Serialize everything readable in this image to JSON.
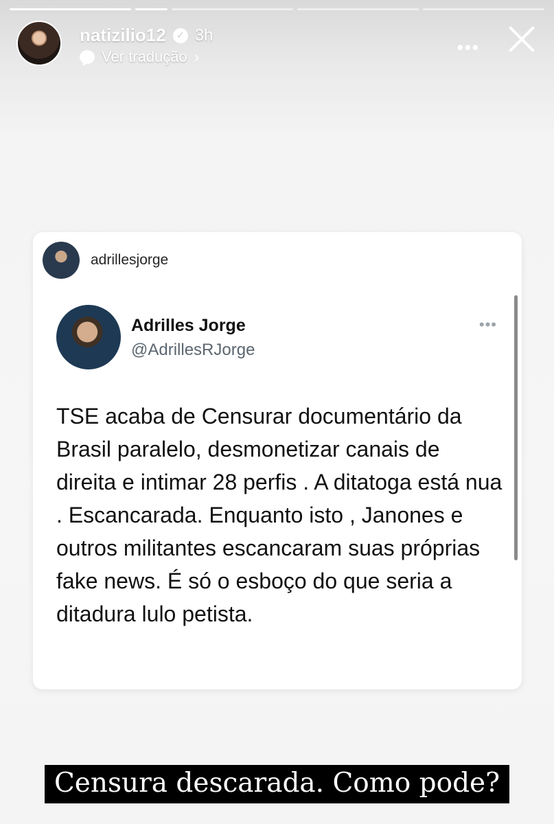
{
  "story": {
    "username": "natizilio12",
    "time": "3h",
    "translate_label": "Ver tradução",
    "chevron": "›",
    "more": "•••",
    "progress": {
      "segments": 5,
      "current": 2
    }
  },
  "shared_post": {
    "username": "adrillesjorge",
    "tweet": {
      "name": "Adrilles Jorge",
      "handle": "@AdrillesRJorge",
      "more": "•••",
      "text": "TSE acaba de Censurar documentário da Brasil paralelo, desmonetizar canais de direita e intimar 28 perfis . A ditatoga está nua . Escancarada. Enquanto isto , Janones e outros militantes escancaram suas próprias fake news. É só o esboço do que seria a ditadura lulo petista."
    }
  },
  "caption": "Censura descarada. Como pode?",
  "colors": {
    "background": "#f4f4f4",
    "card": "#ffffff",
    "caption_bg": "#000000",
    "handle": "#5b6670"
  },
  "icons": [
    "verified-icon",
    "translate-bubble-icon",
    "more-icon",
    "close-icon"
  ]
}
